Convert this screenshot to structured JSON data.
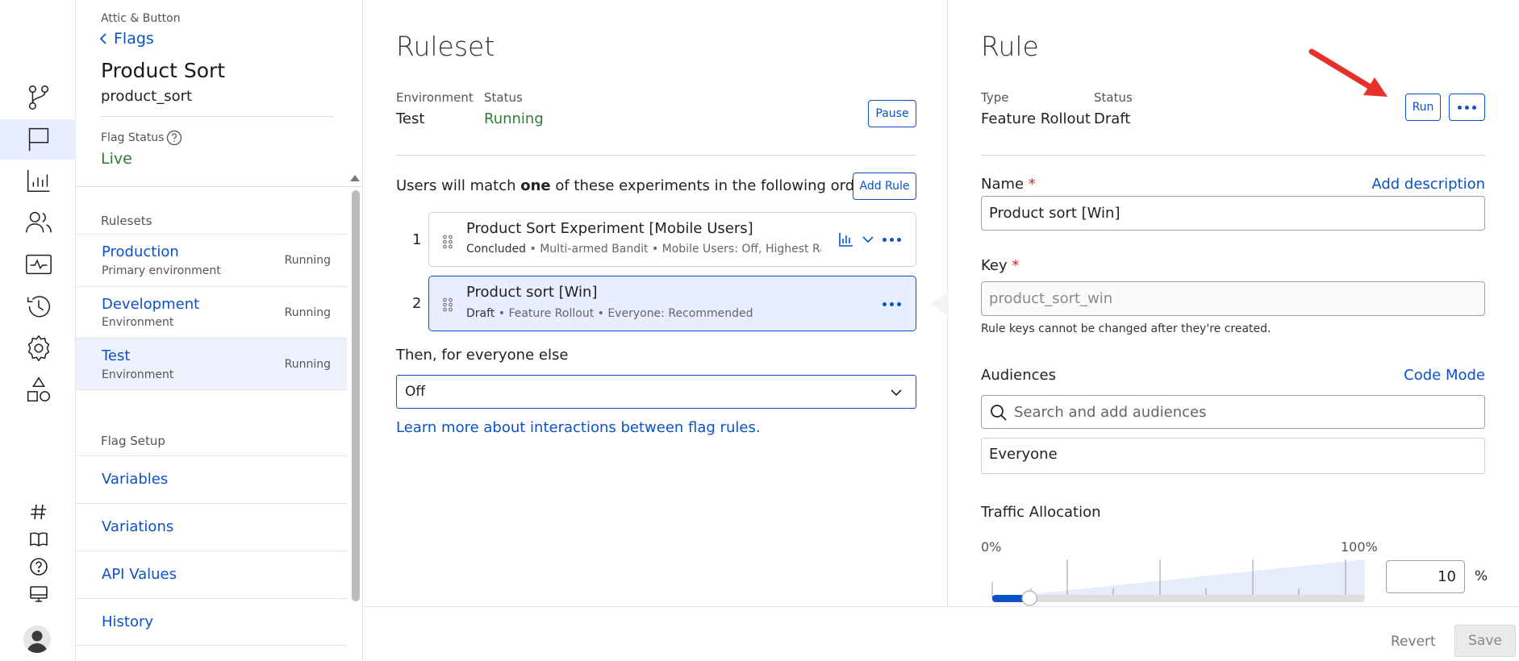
{
  "nav": {
    "breadcrumb": "Attic & Button",
    "back_label": "Flags",
    "flag_name": "Product Sort",
    "flag_key": "product_sort",
    "flag_status_label": "Flag Status",
    "flag_status_value": "Live",
    "rulesets_heading": "Rulesets",
    "rulesets": [
      {
        "name": "Production",
        "sub": "Primary environment",
        "status": "Running"
      },
      {
        "name": "Development",
        "sub": "Environment",
        "status": "Running"
      },
      {
        "name": "Test",
        "sub": "Environment",
        "status": "Running"
      }
    ],
    "setup_heading": "Flag Setup",
    "setup_items": [
      "Variables",
      "Variations",
      "API Values",
      "History"
    ]
  },
  "ruleset": {
    "title": "Ruleset",
    "env_label": "Environment",
    "env_value": "Test",
    "status_label": "Status",
    "status_value": "Running",
    "pause_label": "Pause",
    "match_prefix": "Users will match ",
    "match_bold": "one",
    "match_suffix": " of these experiments in the following order:",
    "add_rule_label": "Add Rule",
    "rules": [
      {
        "index": "1",
        "title": "Product Sort Experiment [Mobile Users]",
        "state": "Concluded",
        "meta": " • Multi-armed Bandit • Mobile Users: Off, Highest Rat..."
      },
      {
        "index": "2",
        "title": "Product sort [Win]",
        "state": "Draft",
        "meta": " • Feature Rollout • Everyone: Recommended"
      }
    ],
    "else_label": "Then, for everyone else",
    "else_value": "Off",
    "learn_link": "Learn more about interactions between flag rules."
  },
  "rule": {
    "title": "Rule",
    "type_label": "Type",
    "type_value": "Feature Rollout",
    "status_label": "Status",
    "status_value": "Draft",
    "run_label": "Run",
    "name_label": "Name",
    "add_description": "Add description",
    "name_value": "Product sort [Win]",
    "key_label": "Key",
    "key_placeholder": "product_sort_win",
    "key_help": "Rule keys cannot be changed after they're created.",
    "audiences_label": "Audiences",
    "code_mode": "Code Mode",
    "audience_search_placeholder": "Search and add audiences",
    "audience_selected": "Everyone",
    "traffic_label": "Traffic Allocation",
    "traffic_min": "0%",
    "traffic_max": "100%",
    "traffic_value": "10",
    "traffic_unit": "%",
    "traffic_fraction": 0.1
  },
  "footer": {
    "revert_label": "Revert",
    "save_label": "Save"
  },
  "colors": {
    "accent": "#0b52c9",
    "running": "#2e7d32",
    "arrow": "#e8302a"
  }
}
